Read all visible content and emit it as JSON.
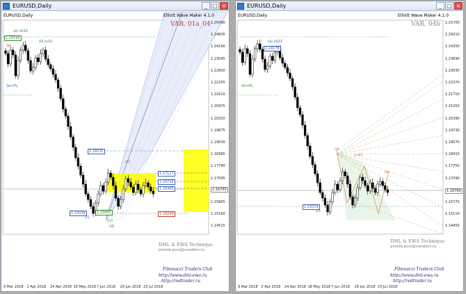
{
  "left": {
    "window_title": "EURUSD,Daily",
    "symbol": "EURUSD,Daily",
    "indicator": "Elliott Wave Maker 4.1.0",
    "variant": "VAR. 01a_04",
    "variant_color": "#c0392b",
    "price_labels": [
      "1.25490",
      "1.24835",
      "1.24190",
      "1.23545",
      "1.22900",
      "1.22255",
      "1.21610",
      "1.20975",
      "1.20320",
      "1.19675",
      "1.19030",
      "1.18385",
      "1.17740",
      "1.17095",
      "1.16450",
      "1.15805",
      "1.15160",
      "1.14515"
    ],
    "current_price": "1.16760",
    "date_labels": [
      "9 Mar 2018",
      "2 Apr 2018",
      "24 Apr 2018",
      "16 May 2018",
      "7 Jun 2018",
      "29 Jun 2018",
      "23 Jul 2018"
    ],
    "wave_labels": [
      "(b)",
      "(a) x022",
      "(ii) iu22",
      "(b)+FL",
      "(c)",
      "(iv)",
      "(e)",
      "(d)"
    ],
    "price_tags": [
      "1.24745",
      "1.18535",
      "1.17117",
      "1.16716",
      "1.16400",
      "1.15099",
      "1.15034",
      "1.15860"
    ],
    "watermark_line1": "DML & EWA Technique",
    "watermark_line2": "putnik-post@rambler.ru",
    "footer_title": "Fibonacci Traders Club",
    "footer_url1": "http://www.dml-ewa.ru",
    "footer_url2": "http://redtrader.ru"
  },
  "right": {
    "window_title": "EURUSD,Daily",
    "symbol": "EURUSD,Daily",
    "indicator": "Elliott Wave Maker 4.1.0",
    "variant": "VAR. 04b",
    "variant_color": "#8a8a8a",
    "price_labels": [
      "1.25700",
      "1.25010",
      "1.24350",
      "1.23690",
      "1.23030",
      "1.22370",
      "1.21710",
      "1.21050",
      "1.20390",
      "1.19730",
      "1.19070",
      "1.18410",
      "1.17750",
      "1.17090",
      "1.16430",
      "1.15770",
      "1.15110",
      "1.14450"
    ],
    "current_price": "1.16760",
    "date_labels": [
      "9 Mar 2018",
      "2 Apr 2018",
      "24 Apr 2018",
      "16 May 2018",
      "7 Jun 2018",
      "29 Jun 2018",
      "23 Jul 2018"
    ],
    "wave_labels": [
      "(a) x022",
      "(b)+FL",
      "(c)",
      "c+FL",
      "(d)",
      "(e)"
    ],
    "price_tags": [
      "1.24178",
      "1.15034"
    ],
    "watermark_line1": "DML & EWA Technique",
    "watermark_line2": "putnik-post@rambler.ru",
    "footer_title": "Fibonacci Traders Club",
    "footer_url1": "http://www.dml-ewa.ru",
    "footer_url2": "http://redtrader.ru"
  }
}
